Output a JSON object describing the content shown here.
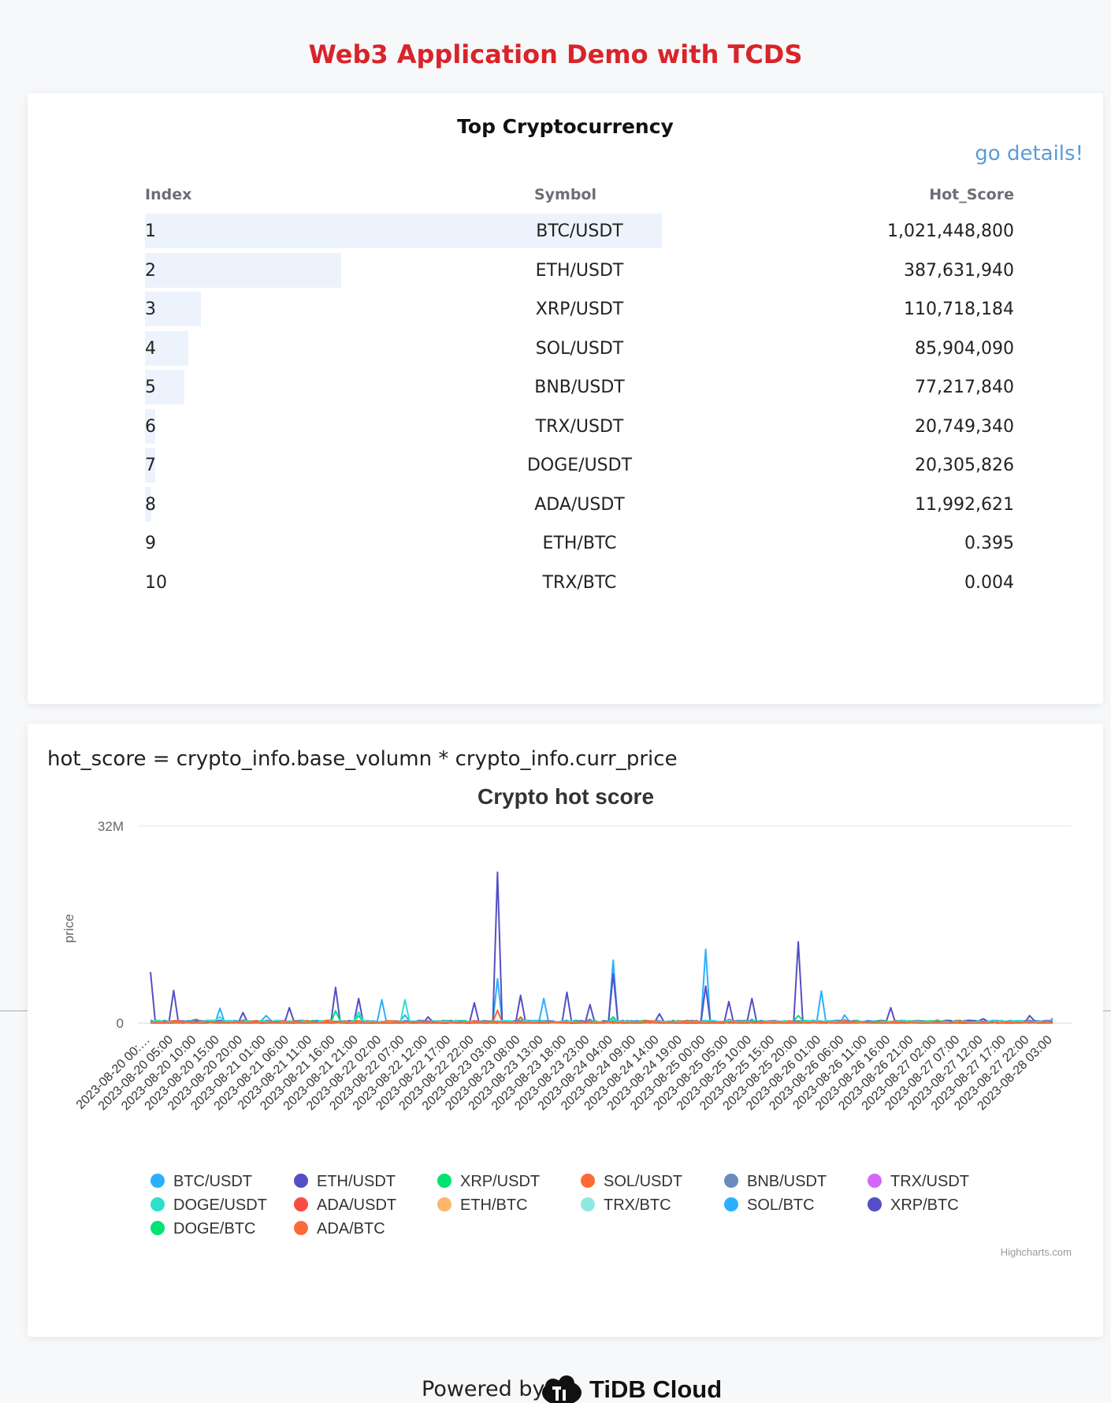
{
  "page": {
    "title": "Web3 Application Demo with TCDS"
  },
  "table": {
    "heading": "Top Cryptocurrency",
    "details_link": "go details!",
    "columns": [
      "Index",
      "Symbol",
      "Hot_Score"
    ],
    "rows": [
      {
        "index": "1",
        "symbol": "BTC/USDT",
        "score": "1,021,448,800",
        "bar_fraction": 1.0
      },
      {
        "index": "2",
        "symbol": "ETH/USDT",
        "score": "387,631,940",
        "bar_fraction": 0.379
      },
      {
        "index": "3",
        "symbol": "XRP/USDT",
        "score": "110,718,184",
        "bar_fraction": 0.108
      },
      {
        "index": "4",
        "symbol": "SOL/USDT",
        "score": "85,904,090",
        "bar_fraction": 0.084
      },
      {
        "index": "5",
        "symbol": "BNB/USDT",
        "score": "77,217,840",
        "bar_fraction": 0.076
      },
      {
        "index": "6",
        "symbol": "TRX/USDT",
        "score": "20,749,340",
        "bar_fraction": 0.02
      },
      {
        "index": "7",
        "symbol": "DOGE/USDT",
        "score": "20,305,826",
        "bar_fraction": 0.02
      },
      {
        "index": "8",
        "symbol": "ADA/USDT",
        "score": "11,992,621",
        "bar_fraction": 0.012
      },
      {
        "index": "9",
        "symbol": "ETH/BTC",
        "score": "0.395",
        "bar_fraction": 0
      },
      {
        "index": "10",
        "symbol": "TRX/BTC",
        "score": "0.004",
        "bar_fraction": 0
      }
    ]
  },
  "formula": "hot_score = crypto_info.base_volumn * crypto_info.curr_price",
  "chart_data": {
    "type": "line",
    "title": "Crypto hot score",
    "xlabel": "",
    "ylabel": "price",
    "ylim": [
      0,
      32000000
    ],
    "y_ticks": [
      "0",
      "32M"
    ],
    "x_tick_labels": [
      "2023-08-20 00:…",
      "2023-08-20 05:00",
      "2023-08-20 10:00",
      "2023-08-20 15:00",
      "2023-08-20 20:00",
      "2023-08-21 01:00",
      "2023-08-21 06:00",
      "2023-08-21 11:00",
      "2023-08-21 16:00",
      "2023-08-21 21:00",
      "2023-08-22 02:00",
      "2023-08-22 07:00",
      "2023-08-22 12:00",
      "2023-08-22 17:00",
      "2023-08-22 22:00",
      "2023-08-23 03:00",
      "2023-08-23 08:00",
      "2023-08-23 13:00",
      "2023-08-23 18:00",
      "2023-08-23 23:00",
      "2023-08-24 04:00",
      "2023-08-24 09:00",
      "2023-08-24 14:00",
      "2023-08-24 19:00",
      "2023-08-25 00:00",
      "2023-08-25 05:00",
      "2023-08-25 10:00",
      "2023-08-25 15:00",
      "2023-08-25 20:00",
      "2023-08-26 01:00",
      "2023-08-26 06:00",
      "2023-08-26 11:00",
      "2023-08-26 16:00",
      "2023-08-26 21:00",
      "2023-08-27 02:00",
      "2023-08-27 07:00",
      "2023-08-27 12:00",
      "2023-08-27 17:00",
      "2023-08-27 22:00",
      "2023-08-28 03:00"
    ],
    "legend_position": "bottom",
    "series": [
      {
        "name": "BTC/USDT",
        "color": "#2caffe",
        "peaks": [
          [
            0,
            0.5
          ],
          [
            3,
            2.4
          ],
          [
            5,
            1.2
          ],
          [
            10,
            3.8
          ],
          [
            11,
            1.3
          ],
          [
            15,
            7.2
          ],
          [
            17,
            4.0
          ],
          [
            20,
            10.2
          ],
          [
            24,
            12.0
          ],
          [
            26,
            0.6
          ],
          [
            29,
            5.2
          ],
          [
            30,
            1.3
          ],
          [
            34,
            0.5
          ],
          [
            39,
            0.8
          ]
        ]
      },
      {
        "name": "ETH/USDT",
        "color": "#544fc5",
        "peaks": [
          [
            0,
            8.3
          ],
          [
            1,
            5.3
          ],
          [
            4,
            1.7
          ],
          [
            6,
            2.5
          ],
          [
            8,
            5.8
          ],
          [
            9,
            4.0
          ],
          [
            12,
            1.0
          ],
          [
            14,
            3.3
          ],
          [
            15,
            24.5
          ],
          [
            16,
            4.5
          ],
          [
            18,
            5.0
          ],
          [
            19,
            3.0
          ],
          [
            20,
            8.0
          ],
          [
            22,
            1.5
          ],
          [
            24,
            6.0
          ],
          [
            25,
            3.5
          ],
          [
            26,
            4.0
          ],
          [
            28,
            13.2
          ],
          [
            30,
            0.5
          ],
          [
            32,
            2.5
          ],
          [
            36,
            0.7
          ],
          [
            38,
            1.2
          ]
        ]
      },
      {
        "name": "XRP/USDT",
        "color": "#00e272",
        "peaks": [
          [
            8,
            2.0
          ],
          [
            9,
            1.2
          ],
          [
            16,
            0.8
          ],
          [
            20,
            1.0
          ],
          [
            28,
            1.2
          ]
        ]
      },
      {
        "name": "SOL/USDT",
        "color": "#fe6a35",
        "peaks": [
          [
            4,
            0.5
          ],
          [
            12,
            0.4
          ],
          [
            15,
            2.1
          ],
          [
            16,
            1.0
          ],
          [
            25,
            0.6
          ]
        ]
      },
      {
        "name": "BNB/USDT",
        "color": "#6b8abc",
        "peaks": [
          [
            2,
            0.6
          ],
          [
            11,
            0.4
          ],
          [
            19,
            0.6
          ],
          [
            27,
            0.4
          ]
        ]
      },
      {
        "name": "TRX/USDT",
        "color": "#d568fb",
        "peaks": []
      },
      {
        "name": "DOGE/USDT",
        "color": "#2ee0ca",
        "peaks": [
          [
            3,
            1.0
          ],
          [
            9,
            1.8
          ],
          [
            11,
            3.8
          ],
          [
            20,
            0.6
          ]
        ]
      },
      {
        "name": "ADA/USDT",
        "color": "#fa4b42",
        "peaks": []
      },
      {
        "name": "ETH/BTC",
        "color": "#feb56a",
        "peaks": []
      },
      {
        "name": "TRX/BTC",
        "color": "#91e8e1",
        "peaks": []
      },
      {
        "name": "SOL/BTC",
        "color": "#2caffe",
        "peaks": []
      },
      {
        "name": "XRP/BTC",
        "color": "#544fc5",
        "peaks": []
      },
      {
        "name": "DOGE/BTC",
        "color": "#00e272",
        "peaks": []
      },
      {
        "name": "ADA/BTC",
        "color": "#fe6a35",
        "peaks": []
      }
    ]
  },
  "credits": "Highcharts.com",
  "footer": {
    "powered_by": "Powered by",
    "brand": "TiDB Cloud"
  }
}
